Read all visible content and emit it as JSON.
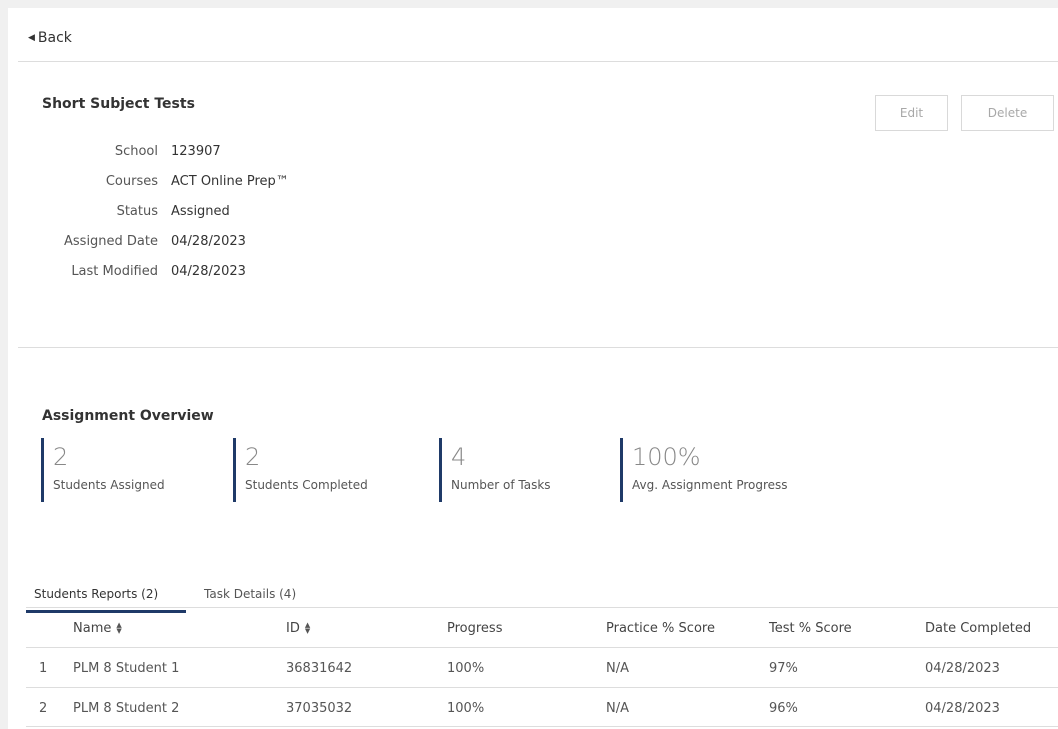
{
  "nav": {
    "back_label": "Back"
  },
  "assignment": {
    "title": "Short Subject Tests",
    "edit_label": "Edit",
    "delete_label": "Delete",
    "details": [
      {
        "label": "School",
        "value": "123907"
      },
      {
        "label": "Courses",
        "value": "ACT Online Prep™"
      },
      {
        "label": "Status",
        "value": "Assigned"
      },
      {
        "label": "Assigned Date",
        "value": "04/28/2023"
      },
      {
        "label": "Last Modified",
        "value": "04/28/2023"
      }
    ]
  },
  "overview": {
    "title": "Assignment Overview",
    "stats": [
      {
        "value": "2",
        "label": "Students Assigned"
      },
      {
        "value": "2",
        "label": "Students Completed"
      },
      {
        "value": "4",
        "label": "Number of Tasks"
      },
      {
        "value": "100%",
        "label": "Avg. Assignment Progress"
      }
    ]
  },
  "tabs": [
    {
      "label": "Students Reports (2)",
      "active": true
    },
    {
      "label": "Task Details (4)",
      "active": false
    }
  ],
  "table": {
    "headers": {
      "name": "Name",
      "id": "ID",
      "progress": "Progress",
      "practice": "Practice % Score",
      "test": "Test % Score",
      "date": "Date Completed"
    },
    "rows": [
      {
        "index": "1",
        "name": "PLM 8 Student 1",
        "id": "36831642",
        "progress": "100%",
        "practice": "N/A",
        "test": "97%",
        "date": "04/28/2023"
      },
      {
        "index": "2",
        "name": "PLM 8 Student 2",
        "id": "37035032",
        "progress": "100%",
        "practice": "N/A",
        "test": "96%",
        "date": "04/28/2023"
      }
    ]
  },
  "colors": {
    "accent": "#1f3a68",
    "border": "#dddddd",
    "text": "#333333",
    "muted": "#888888"
  }
}
